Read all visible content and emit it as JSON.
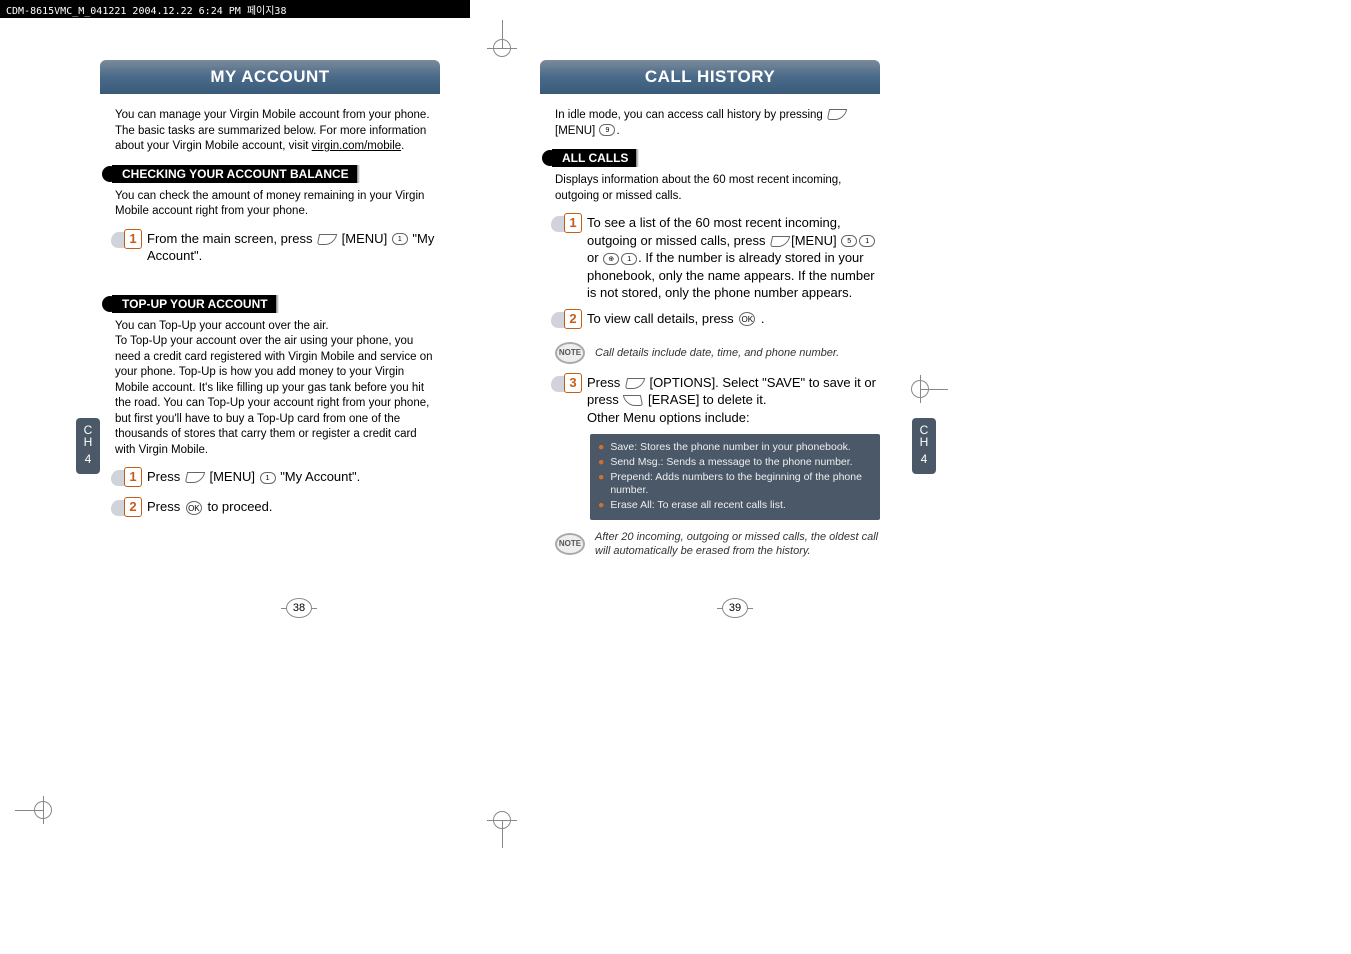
{
  "header_strip": "CDM-8615VMC_M_041221  2004.12.22  6:24 PM  페이지38",
  "left": {
    "title": "MY ACCOUNT",
    "intro_1": "You can manage your Virgin Mobile account from your phone. The basic tasks are summarized below. For more information about your Virgin Mobile account, visit ",
    "intro_link": "virgin.com/mobile",
    "intro_2": ".",
    "section1": "CHECKING YOUR ACCOUNT BALANCE",
    "section1_body": "You can check the amount of money remaining in your Virgin Mobile account right from your phone.",
    "s1_step1_a": "From the main screen, press ",
    "s1_step1_b": " [MENU] ",
    "s1_step1_c": " \"My Account\".",
    "section2": "TOP-UP YOUR ACCOUNT",
    "section2_body": "You can Top-Up your account over the air.\nTo Top-Up your account over the air using your phone, you need a credit card registered with Virgin Mobile and service on your phone. Top-Up is how you add money to your Virgin Mobile account. It's like filling up your gas tank before you hit the road. You can Top-Up your account right from your phone, but first you'll have to buy a Top-Up card from one of the thousands of stores that carry them or register a credit card with Virgin Mobile.",
    "s2_step1_a": "Press ",
    "s2_step1_b": " [MENU] ",
    "s2_step1_c": " \"My Account\".",
    "s2_step2_a": "Press ",
    "s2_step2_b": " to proceed.",
    "page_num": "38",
    "ch_label": "C\nH",
    "ch_num": "4"
  },
  "right": {
    "title": "CALL HISTORY",
    "intro_a": "In idle mode, you can access call history by pressing ",
    "intro_b": " [MENU] ",
    "intro_c": ".",
    "section1": "ALL CALLS",
    "section1_body": "Displays information about the 60 most recent incoming, outgoing or missed calls.",
    "s1_step1_a": "To see a list of the 60 most recent incoming, outgoing or missed calls, press ",
    "s1_step1_b": "[MENU] ",
    "s1_step1_c": " or ",
    "s1_step1_d": ". If the number is already stored in your phonebook, only the name appears. If the number is not stored, only the phone number appears.",
    "s1_step2_a": "To view call details, press ",
    "s1_step2_b": " .",
    "note1": "Call details include date, time, and phone number.",
    "s1_step3_a": "Press ",
    "s1_step3_b": " [OPTIONS]. Select \"SAVE\" to save it or press ",
    "s1_step3_c": " [ERASE] to delete it.",
    "s1_step3_d": "Other Menu options include:",
    "options": [
      "Save: Stores the phone number in your phonebook.",
      "Send Msg.: Sends a message to the phone number.",
      "Prepend: Adds numbers to the beginning of the phone number.",
      "Erase All: To erase all recent calls list."
    ],
    "note2": "After 20 incoming, outgoing or missed calls, the oldest call will automatically be erased from the history.",
    "page_num": "39",
    "ch_label": "C\nH",
    "ch_num": "4"
  },
  "key_9": "9",
  "key_5": "5",
  "key_1": "1",
  "ok_label": "OK",
  "note_label": "NOTE"
}
